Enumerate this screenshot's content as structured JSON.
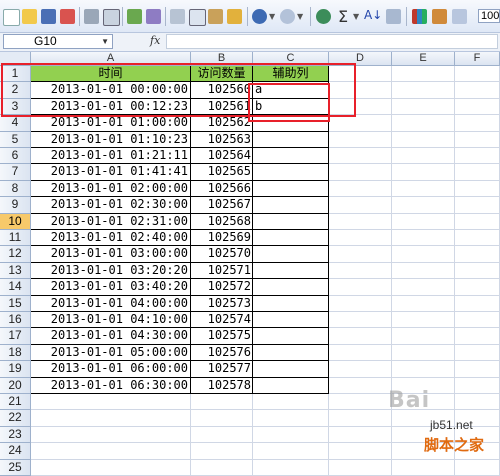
{
  "toolbar": {
    "sigma": "Σ",
    "sort_label": "A↓",
    "zoom": "100"
  },
  "formula_bar": {
    "name_box": "G10",
    "fx_label": "fx",
    "formula": ""
  },
  "columns": [
    "A",
    "B",
    "C",
    "D",
    "E",
    "F"
  ],
  "headers": {
    "a": "时间",
    "b": "访问数量",
    "c": "辅助列"
  },
  "rows": [
    {
      "n": "1"
    },
    {
      "n": "2",
      "a": "2013-01-01 00:00:00",
      "b": "102560",
      "c": "a"
    },
    {
      "n": "3",
      "a": "2013-01-01 00:12:23",
      "b": "102561",
      "c": "b"
    },
    {
      "n": "4",
      "a": "2013-01-01 01:00:00",
      "b": "102562"
    },
    {
      "n": "5",
      "a": "2013-01-01 01:10:23",
      "b": "102563"
    },
    {
      "n": "6",
      "a": "2013-01-01 01:21:11",
      "b": "102564"
    },
    {
      "n": "7",
      "a": "2013-01-01 01:41:41",
      "b": "102565"
    },
    {
      "n": "8",
      "a": "2013-01-01 02:00:00",
      "b": "102566"
    },
    {
      "n": "9",
      "a": "2013-01-01 02:30:00",
      "b": "102567"
    },
    {
      "n": "10",
      "a": "2013-01-01 02:31:00",
      "b": "102568"
    },
    {
      "n": "11",
      "a": "2013-01-01 02:40:00",
      "b": "102569"
    },
    {
      "n": "12",
      "a": "2013-01-01 03:00:00",
      "b": "102570"
    },
    {
      "n": "13",
      "a": "2013-01-01 03:20:20",
      "b": "102571"
    },
    {
      "n": "14",
      "a": "2013-01-01 03:40:20",
      "b": "102572"
    },
    {
      "n": "15",
      "a": "2013-01-01 04:00:00",
      "b": "102573"
    },
    {
      "n": "16",
      "a": "2013-01-01 04:10:00",
      "b": "102574"
    },
    {
      "n": "17",
      "a": "2013-01-01 04:30:00",
      "b": "102575"
    },
    {
      "n": "18",
      "a": "2013-01-01 05:00:00",
      "b": "102576"
    },
    {
      "n": "19",
      "a": "2013-01-01 06:00:00",
      "b": "102577"
    },
    {
      "n": "20",
      "a": "2013-01-01 06:30:00",
      "b": "102578"
    },
    {
      "n": "21"
    },
    {
      "n": "22"
    },
    {
      "n": "23"
    },
    {
      "n": "24"
    },
    {
      "n": "25"
    }
  ],
  "selected_row": "10",
  "watermark": {
    "logo": "Bai",
    "site": "jb51.net",
    "name": "脚本之家"
  },
  "colors": {
    "header_fill": "#92d050",
    "highlight_box": "#e8202a",
    "selected_row_header": "#f7c96a"
  }
}
